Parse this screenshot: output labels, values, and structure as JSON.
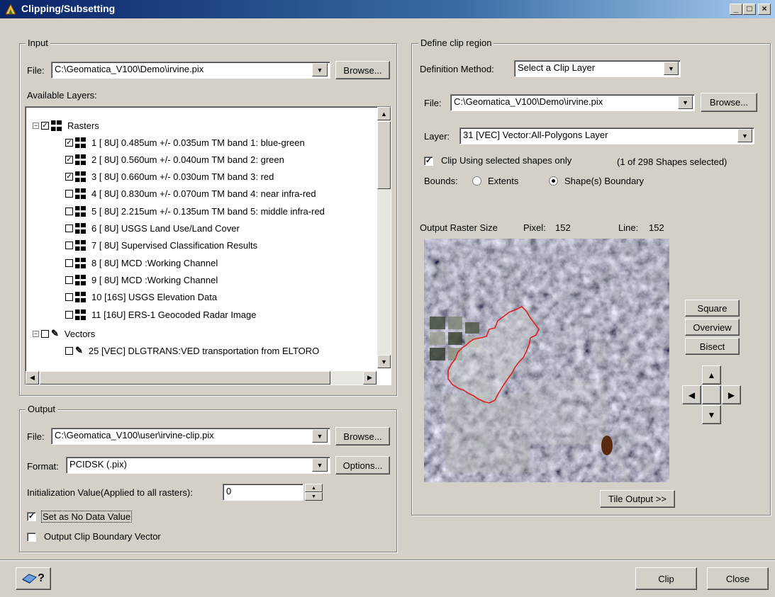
{
  "window": {
    "title": "Clipping/Subsetting",
    "min": "_",
    "max": "□",
    "close": "×"
  },
  "input": {
    "group_label": "Input",
    "file_label": "File:",
    "file_value": "C:\\Geomatica_V100\\Demo\\irvine.pix",
    "browse": "Browse...",
    "available_layers_label": "Available Layers:",
    "rasters_label": "Rasters",
    "vectors_label": "Vectors",
    "raster_layers": [
      {
        "label": "1 [ 8U] 0.485um +/- 0.035um  TM band 1: blue-green",
        "checked": true
      },
      {
        "label": "2 [ 8U] 0.560um +/- 0.040um  TM band 2: green",
        "checked": true
      },
      {
        "label": "3 [ 8U] 0.660um +/- 0.030um  TM band 3: red",
        "checked": true
      },
      {
        "label": "4 [ 8U] 0.830um +/- 0.070um  TM band 4: near infra-red",
        "checked": false
      },
      {
        "label": "5 [ 8U] 2.215um +/- 0.135um  TM band 5: middle infra-red",
        "checked": false
      },
      {
        "label": "6 [ 8U] USGS Land Use/Land Cover",
        "checked": false
      },
      {
        "label": "7 [ 8U] Supervised Classification Results",
        "checked": false
      },
      {
        "label": "8 [ 8U] MCD    :Working Channel",
        "checked": false
      },
      {
        "label": "9 [ 8U] MCD    :Working Channel",
        "checked": false
      },
      {
        "label": "10 [16S] USGS Elevation Data",
        "checked": false
      },
      {
        "label": "11 [16U] ERS-1 Geocoded Radar Image",
        "checked": false
      }
    ],
    "vector_layers": [
      {
        "label": "25 [VEC] DLGTRANS:VED transportation from ELTORO",
        "checked": false
      }
    ]
  },
  "output": {
    "group_label": "Output",
    "file_label": "File:",
    "file_value": "C:\\Geomatica_V100\\user\\irvine-clip.pix",
    "browse": "Browse...",
    "format_label": "Format:",
    "format_value": "PCIDSK (.pix)",
    "options": "Options...",
    "init_label": "Initialization Value(Applied to all rasters):",
    "init_value": "0",
    "set_nodata_label": "Set as No Data Value",
    "set_nodata_checked": true,
    "output_clip_label": "Output Clip Boundary Vector",
    "output_clip_checked": false
  },
  "clip": {
    "group_label": "Define clip region",
    "method_label": "Definition Method:",
    "method_value": "Select a Clip Layer",
    "file_label": "File:",
    "file_value": "C:\\Geomatica_V100\\Demo\\irvine.pix",
    "browse": "Browse...",
    "layer_label": "Layer:",
    "layer_value": "31 [VEC] Vector:All-Polygons Layer",
    "clip_selected_label": "Clip Using selected shapes only",
    "clip_selected_checked": true,
    "shapes_selected": "(1  of  298 Shapes selected)",
    "bounds_label": "Bounds:",
    "bounds_extents": "Extents",
    "bounds_shape": "Shape(s) Boundary",
    "bounds_selected": "shape",
    "raster_size_label": "Output Raster Size",
    "pixel_label": "Pixel:",
    "pixel_value": "152",
    "line_label": "Line:",
    "line_value": "152",
    "square": "Square",
    "overview": "Overview",
    "bisect": "Bisect",
    "tile_output": "Tile Output >>"
  },
  "footer": {
    "help_icon": "?",
    "clip": "Clip",
    "close": "Close"
  }
}
